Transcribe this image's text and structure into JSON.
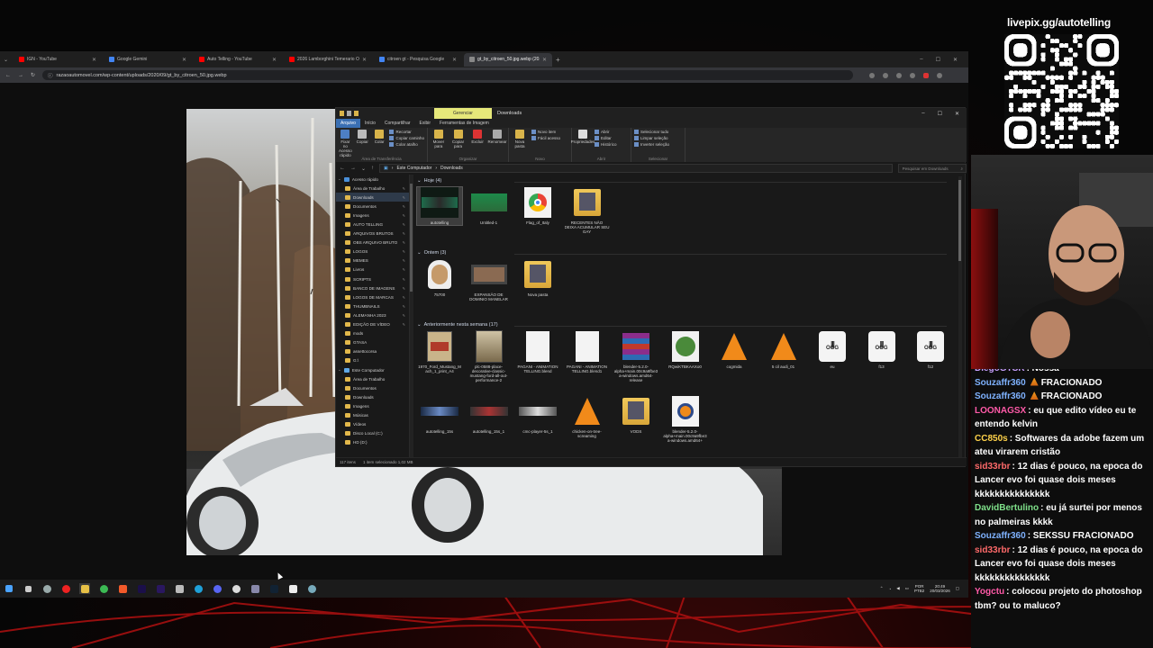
{
  "browser": {
    "tabs": [
      {
        "label": "IGN - YouTube",
        "color": "#ff0000"
      },
      {
        "label": "Google Gemini",
        "color": "#4285f4"
      },
      {
        "label": "Auto Telling - YouTube",
        "color": "#ff0000"
      },
      {
        "label": "2026 Lamborghini Temerario O",
        "color": "#ff0000"
      },
      {
        "label": "citroen gt - Pesquisa Google",
        "color": "#4285f4"
      },
      {
        "label": "gt_by_citroen_50.jpg.webp (20...",
        "color": "#888888",
        "active": true
      }
    ],
    "new_tab_label": "+",
    "url": "razaoautomovel.com/wp-content/uploads/2020/09/gt_by_citroen_50.jpg.webp"
  },
  "explorer": {
    "context_tab": "Gerenciar",
    "title": "Downloads",
    "ribbon_tabs": [
      "Arquivo",
      "Início",
      "Compartilhar",
      "Exibir",
      "Ferramentas de Imagem"
    ],
    "ribbon": {
      "clipboard": {
        "group": "Área de Transferência",
        "pin_label": "Fixar no Acesso rápido",
        "copy_label": "Copiar",
        "paste_label": "Colar",
        "cut_label": "Recortar",
        "copy_path_label": "Copiar caminho",
        "paste_shortcut_label": "Colar atalho"
      },
      "organize": {
        "group": "Organizar",
        "move_label": "Mover para",
        "copy_to_label": "Copiar para",
        "delete_label": "Excluir",
        "rename_label": "Renomear"
      },
      "new": {
        "group": "Novo",
        "new_folder_label": "Nova pasta",
        "new_item_label": "Novo item",
        "easy_access_label": "Fácil acesso"
      },
      "open": {
        "group": "Abrir",
        "properties_label": "Propriedades",
        "open_label": "Abrir",
        "edit_label": "Editar",
        "history_label": "Histórico"
      },
      "select": {
        "group": "Selecionar",
        "select_all_label": "Selecionar tudo",
        "clear_label": "Limpar seleção",
        "invert_label": "Inverter seleção"
      }
    },
    "breadcrumb": [
      "Este Computador",
      "Downloads"
    ],
    "search_placeholder": "Pesquisar em Downloads",
    "sidebar": [
      {
        "label": "Acesso rápido",
        "section": true,
        "icon": "star-icon"
      },
      {
        "label": "Área de Trabalho",
        "pin": true
      },
      {
        "label": "Downloads",
        "pin": true,
        "selected": true
      },
      {
        "label": "Documentos",
        "pin": true
      },
      {
        "label": "Imagens",
        "pin": true
      },
      {
        "label": "AUTO TELLING",
        "pin": true
      },
      {
        "label": "ARQUIVOS BRUTOS",
        "pin": true
      },
      {
        "label": "OBS ARQUIVO BRUTO",
        "pin": true
      },
      {
        "label": "LOGOS",
        "pin": true
      },
      {
        "label": "MEMES",
        "pin": true
      },
      {
        "label": "Livros",
        "pin": true
      },
      {
        "label": "SCRIPTS",
        "pin": true
      },
      {
        "label": "BANCO DE IMAGENS",
        "pin": true
      },
      {
        "label": "LOGOS DE MARCAS",
        "pin": true
      },
      {
        "label": "THUMBNAILS",
        "pin": true
      },
      {
        "label": "ALEMANHA 2023",
        "pin": true
      },
      {
        "label": "EDIÇÃO DE VÍDEO",
        "pin": true
      },
      {
        "label": "mods",
        "pin": false
      },
      {
        "label": "GTASA",
        "pin": false
      },
      {
        "label": "assettocorsa",
        "pin": false
      },
      {
        "label": "G:\\",
        "pin": false
      },
      {
        "label": "Este Computador",
        "section": true,
        "icon": "pc-icon"
      },
      {
        "label": "Área de Trabalho",
        "pin": false
      },
      {
        "label": "Documentos",
        "pin": false
      },
      {
        "label": "Downloads",
        "pin": false
      },
      {
        "label": "Imagens",
        "pin": false
      },
      {
        "label": "Músicas",
        "pin": false
      },
      {
        "label": "Vídeos",
        "pin": false
      },
      {
        "label": "Disco Local (C:)",
        "pin": false
      },
      {
        "label": "HD (D:)",
        "pin": false
      }
    ],
    "groups": [
      {
        "title": "Hoje (4)"
      },
      {
        "title": "Ontem (3)"
      },
      {
        "title": "Anteriormente nesta semana (17)"
      }
    ],
    "files_today": [
      {
        "name": "autotelling",
        "kind": "video",
        "selected": true
      },
      {
        "name": "Untitled-1",
        "kind": "green"
      },
      {
        "name": "Flag_of_Italy",
        "kind": "chrome"
      },
      {
        "name": "RECENTES NÃO DEIXA ACUMULAR SEU GAY",
        "kind": "folder"
      }
    ],
    "files_yesterday": [
      {
        "name": "75700",
        "kind": "face"
      },
      {
        "name": "EXPANSÃO DE DOMINIO MANELAR",
        "kind": "photo"
      },
      {
        "name": "Nova pasta",
        "kind": "folder"
      }
    ],
    "files_week": [
      {
        "name": "1970_Ford_Mustang_Mach_1_print_A4",
        "kind": "car"
      },
      {
        "name": "plc-0588-place-decorative-classic-mustang-ford-all-out-performance-2",
        "kind": "poster"
      },
      {
        "name": "PAGANI - ANIMATION TELLING.blend",
        "kind": "doc"
      },
      {
        "name": "PAGANI - ANIMATION TELLING.blend1",
        "kind": "doc"
      },
      {
        "name": "blender-5.2.0-alpha+main.00c9a9fbe3a-windows.amd64-release",
        "kind": "rar"
      },
      {
        "name": "RQwiKTBKAAXo0",
        "kind": "pic"
      },
      {
        "name": "cogmida",
        "kind": "vlc"
      },
      {
        "name": "5 cil audi_01",
        "kind": "vlc"
      },
      {
        "name": "eu",
        "kind": "ogg"
      },
      {
        "name": "f13",
        "kind": "ogg"
      },
      {
        "name": "f12",
        "kind": "ogg"
      },
      {
        "name": "autotelling_15s",
        "kind": "strip"
      },
      {
        "name": "autotelling_15s_1",
        "kind": "strip2"
      },
      {
        "name": "cmc-player-5s_1",
        "kind": "strip3"
      },
      {
        "name": "chicken-on-tree-screaming",
        "kind": "vlc"
      },
      {
        "name": "VODS",
        "kind": "folder"
      },
      {
        "name": "blender-5.2.0-alpha+main.00c9a9fbe3a-windows.amd64+",
        "kind": "blender"
      }
    ],
    "status": {
      "count": "117 itens",
      "selection": "1 item selecionado  1,02 MB"
    },
    "ogg_label": "OGG"
  },
  "taskbar": {
    "lang_top": "POR",
    "lang_bottom": "PTB2",
    "time": "20:49",
    "date": "20/03/2026"
  },
  "overlay": {
    "livepix": "livepix.gg/autotelling"
  },
  "chat": [
    {
      "user": "DiegoGTSR",
      "color": "#c8a0ff",
      "text": ": Nossa"
    },
    {
      "user": "Souzaffr360",
      "color": "#7fb2ff",
      "badge": true,
      "text": "FRACIONADO"
    },
    {
      "user": "Souzaffr360",
      "color": "#7fb2ff",
      "badge": true,
      "text": "FRACIONADO"
    },
    {
      "user": "LOONAGSX",
      "color": "#ff5aa8",
      "text": ": eu que edito vídeo eu te entendo kelvin"
    },
    {
      "user": "CC850s",
      "color": "#ffd24a",
      "text": ": Softwares da adobe fazem um ateu virarem cristão"
    },
    {
      "user": "sid33rbr",
      "color": "#ff6a6a",
      "text": ": 12 dias é pouco, na epoca do Lancer evo foi quase dois meses kkkkkkkkkkkkkkk"
    },
    {
      "user": "DavidBertulino",
      "color": "#7fe08a",
      "text": ": eu já surtei por menos no palmeiras kkkk"
    },
    {
      "user": "Souzaffr360",
      "color": "#7fb2ff",
      "text": ": SEKSSU FRACIONADO"
    },
    {
      "user": "sid33rbr",
      "color": "#ff6a6a",
      "text": ": 12 dias é pouco, na epoca do Lancer evo foi quase dois meses kkkkkkkkkkkkkkk"
    },
    {
      "user": "Yogctu",
      "color": "#ff5aa8",
      "text": ": colocou projeto do photoshop tbm? ou to maluco?"
    }
  ]
}
